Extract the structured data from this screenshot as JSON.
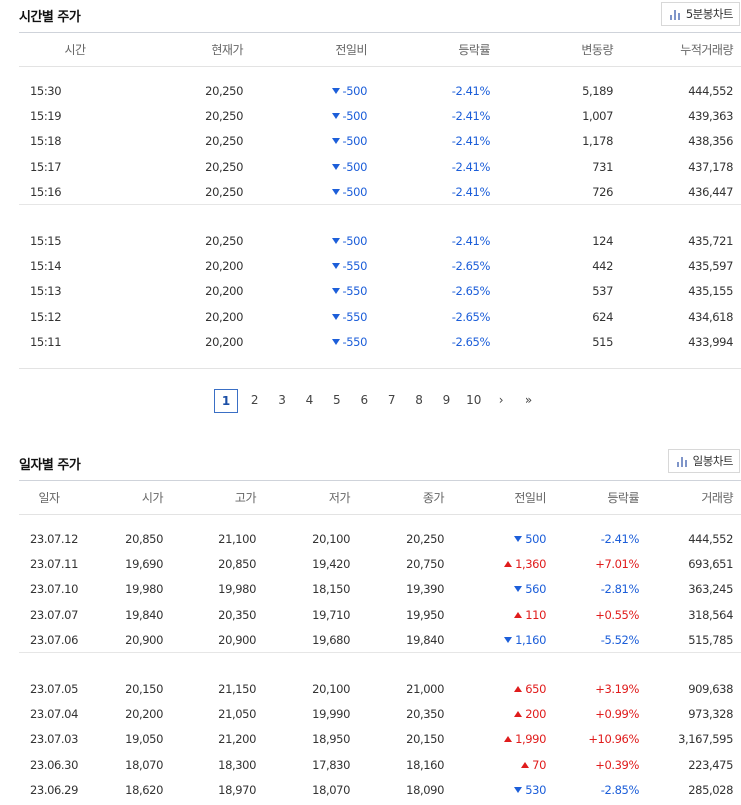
{
  "time_section": {
    "title": "시간별 주가",
    "chart_button": "5분봉차트",
    "headers": [
      "시간",
      "현재가",
      "전일비",
      "등락률",
      "변동량",
      "누적거래량"
    ],
    "groups": [
      [
        {
          "time": "15:30",
          "price": "20,250",
          "dir": "dn",
          "diff": "-500",
          "rate": "-2.41%",
          "change": "5,189",
          "cum": "444,552"
        },
        {
          "time": "15:19",
          "price": "20,250",
          "dir": "dn",
          "diff": "-500",
          "rate": "-2.41%",
          "change": "1,007",
          "cum": "439,363"
        },
        {
          "time": "15:18",
          "price": "20,250",
          "dir": "dn",
          "diff": "-500",
          "rate": "-2.41%",
          "change": "1,178",
          "cum": "438,356"
        },
        {
          "time": "15:17",
          "price": "20,250",
          "dir": "dn",
          "diff": "-500",
          "rate": "-2.41%",
          "change": "731",
          "cum": "437,178"
        },
        {
          "time": "15:16",
          "price": "20,250",
          "dir": "dn",
          "diff": "-500",
          "rate": "-2.41%",
          "change": "726",
          "cum": "436,447"
        }
      ],
      [
        {
          "time": "15:15",
          "price": "20,250",
          "dir": "dn",
          "diff": "-500",
          "rate": "-2.41%",
          "change": "124",
          "cum": "435,721"
        },
        {
          "time": "15:14",
          "price": "20,200",
          "dir": "dn",
          "diff": "-550",
          "rate": "-2.65%",
          "change": "442",
          "cum": "435,597"
        },
        {
          "time": "15:13",
          "price": "20,200",
          "dir": "dn",
          "diff": "-550",
          "rate": "-2.65%",
          "change": "537",
          "cum": "435,155"
        },
        {
          "time": "15:12",
          "price": "20,200",
          "dir": "dn",
          "diff": "-550",
          "rate": "-2.65%",
          "change": "624",
          "cum": "434,618"
        },
        {
          "time": "15:11",
          "price": "20,200",
          "dir": "dn",
          "diff": "-550",
          "rate": "-2.65%",
          "change": "515",
          "cum": "433,994"
        }
      ]
    ]
  },
  "pagination": {
    "pages": [
      "1",
      "2",
      "3",
      "4",
      "5",
      "6",
      "7",
      "8",
      "9",
      "10"
    ],
    "current": "1",
    "next": "›",
    "last": "»"
  },
  "daily_section": {
    "title": "일자별 주가",
    "chart_button": "일봉차트",
    "headers": [
      "일자",
      "시가",
      "고가",
      "저가",
      "종가",
      "전일비",
      "등락률",
      "거래량"
    ],
    "groups": [
      [
        {
          "date": "23.07.12",
          "open": "20,850",
          "high": "21,100",
          "low": "20,100",
          "close": "20,250",
          "dir": "dn",
          "diff": "500",
          "rate": "-2.41%",
          "volume": "444,552"
        },
        {
          "date": "23.07.11",
          "open": "19,690",
          "high": "20,850",
          "low": "19,420",
          "close": "20,750",
          "dir": "up",
          "diff": "1,360",
          "rate": "+7.01%",
          "volume": "693,651"
        },
        {
          "date": "23.07.10",
          "open": "19,980",
          "high": "19,980",
          "low": "18,150",
          "close": "19,390",
          "dir": "dn",
          "diff": "560",
          "rate": "-2.81%",
          "volume": "363,245"
        },
        {
          "date": "23.07.07",
          "open": "19,840",
          "high": "20,350",
          "low": "19,710",
          "close": "19,950",
          "dir": "up",
          "diff": "110",
          "rate": "+0.55%",
          "volume": "318,564"
        },
        {
          "date": "23.07.06",
          "open": "20,900",
          "high": "20,900",
          "low": "19,680",
          "close": "19,840",
          "dir": "dn",
          "diff": "1,160",
          "rate": "-5.52%",
          "volume": "515,785"
        }
      ],
      [
        {
          "date": "23.07.05",
          "open": "20,150",
          "high": "21,150",
          "low": "20,100",
          "close": "21,000",
          "dir": "up",
          "diff": "650",
          "rate": "+3.19%",
          "volume": "909,638"
        },
        {
          "date": "23.07.04",
          "open": "20,200",
          "high": "21,050",
          "low": "19,990",
          "close": "20,350",
          "dir": "up",
          "diff": "200",
          "rate": "+0.99%",
          "volume": "973,328"
        },
        {
          "date": "23.07.03",
          "open": "19,050",
          "high": "21,200",
          "low": "18,950",
          "close": "20,150",
          "dir": "up",
          "diff": "1,990",
          "rate": "+10.96%",
          "volume": "3,167,595"
        },
        {
          "date": "23.06.30",
          "open": "18,070",
          "high": "18,300",
          "low": "17,830",
          "close": "18,160",
          "dir": "up",
          "diff": "70",
          "rate": "+0.39%",
          "volume": "223,475"
        },
        {
          "date": "23.06.29",
          "open": "18,620",
          "high": "18,970",
          "low": "18,070",
          "close": "18,090",
          "dir": "dn",
          "diff": "530",
          "rate": "-2.85%",
          "volume": "285,028"
        }
      ]
    ]
  },
  "colors": {
    "down": "#1c5ed9",
    "up": "#e01c1c",
    "active_page_border": "#3a6fc5"
  }
}
